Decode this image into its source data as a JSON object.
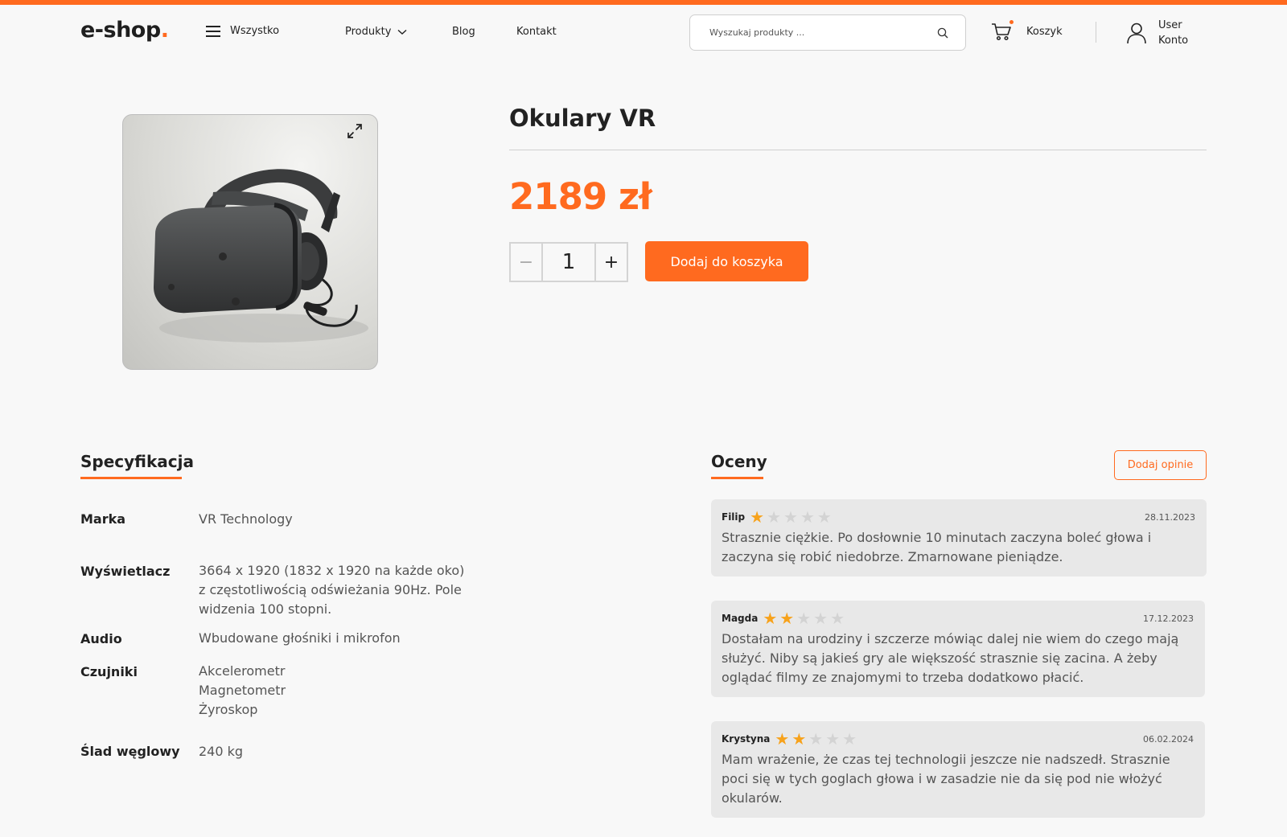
{
  "brand": {
    "logo_text": "e-shop",
    "logo_dot": "."
  },
  "header": {
    "menu_all": "Wszystko",
    "nav": {
      "products": "Produkty",
      "blog": "Blog",
      "contact": "Kontakt"
    },
    "search": {
      "placeholder": "Wyszukaj produkty ...",
      "value": ""
    },
    "cart_label": "Koszyk",
    "account_line1": "User",
    "account_line2": "Konto"
  },
  "product": {
    "title": "Okulary VR",
    "price": "2189 zł",
    "quantity": "1",
    "add_to_cart": "Dodaj do koszyka",
    "qty_minus": "−",
    "qty_plus": "+"
  },
  "specs": {
    "title": "Specyfikacja",
    "rows": [
      {
        "label": "Marka",
        "value": "VR Technology"
      },
      {
        "label": "Wyświetlacz",
        "value": "3664 x 1920 (1832 x 1920 na każde oko) z częstotliwością odświeżania 90Hz. Pole widzenia 100 stopni."
      },
      {
        "label": "Audio",
        "value": "Wbudowane głośniki i mikrofon"
      },
      {
        "label": "Czujniki",
        "value": [
          "Akcelerometr",
          "Magnetometr",
          "Żyroskop"
        ]
      },
      {
        "label": "Ślad węglowy",
        "value": "240 kg"
      }
    ]
  },
  "reviews": {
    "title": "Oceny",
    "add_label": "Dodaj opinie",
    "items": [
      {
        "author": "Filip",
        "rating": 1,
        "max": 5,
        "date": "28.11.2023",
        "text": "Strasznie ciężkie. Po dosłownie 10 minutach zaczyna boleć głowa i zaczyna się robić niedobrze. Zmarnowane pieniądze."
      },
      {
        "author": "Magda",
        "rating": 2,
        "max": 5,
        "date": "17.12.2023",
        "text": "Dostałam na urodziny i szczerze mówiąc dalej nie wiem do czego mają służyć. Niby są jakieś gry ale większość strasznie się zacina. A żeby oglądać filmy ze znajomymi to trzeba dodatkowo płacić."
      },
      {
        "author": "Krystyna",
        "rating": 2,
        "max": 5,
        "date": "06.02.2024",
        "text": "Mam wrażenie, że czas tej technologii jeszcze nie nadszedł. Strasznie poci się w tych goglach głowa i w zasadzie nie da się pod nie włożyć okularów."
      }
    ]
  },
  "colors": {
    "accent": "#ff6a1f",
    "star_on": "#f7a21b",
    "star_off": "#d3d3d3"
  },
  "icons": {
    "menu": "hamburger-icon",
    "chevron": "chevron-down-icon",
    "search": "search-icon",
    "cart": "cart-icon",
    "user": "user-icon",
    "expand": "expand-icon",
    "star": "star-icon"
  }
}
